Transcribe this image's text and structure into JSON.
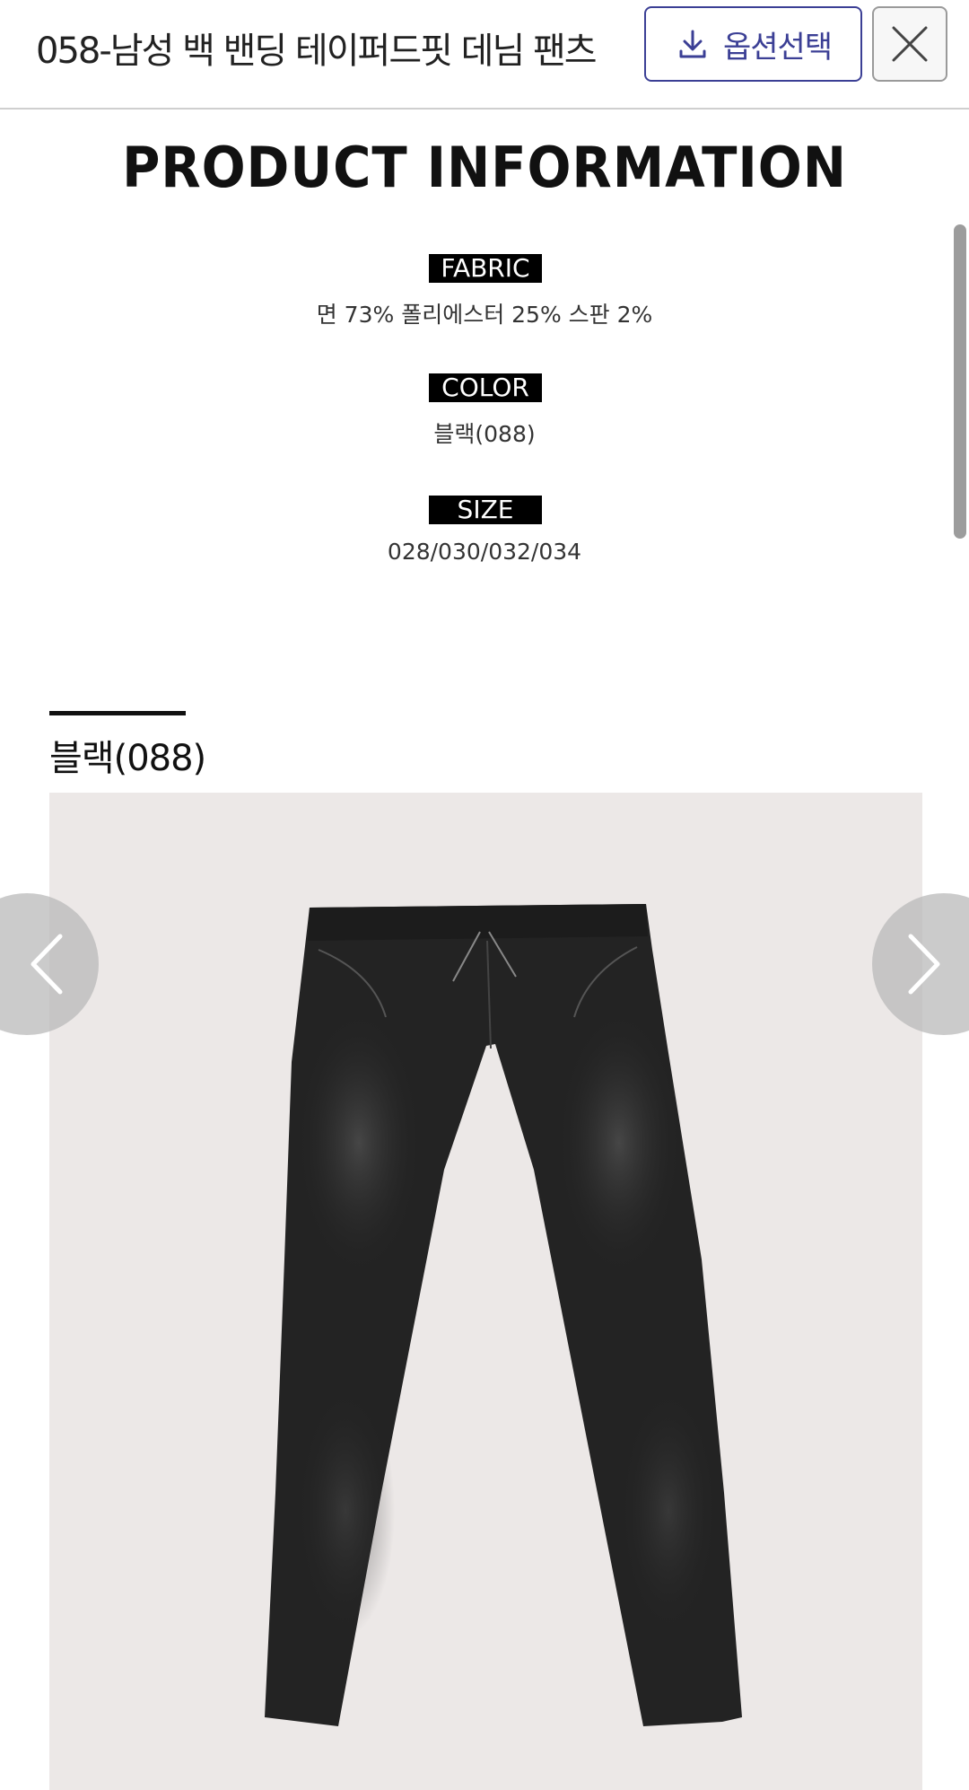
{
  "header": {
    "title": "058-남성 백 밴딩 테이퍼드핏 데님 팬츠",
    "option_button_label": "옵션선택",
    "option_icon": "download-icon",
    "close_icon": "close-icon"
  },
  "product_info": {
    "title": "PRODUCT INFORMATION",
    "fabric_label": "FABRIC",
    "fabric_value": "면 73% 폴리에스터 25% 스판 2%",
    "color_label": "COLOR",
    "color_value": "블랙(088)",
    "size_label": "SIZE",
    "size_value": "028/030/032/034"
  },
  "color_section": {
    "label": "블랙(088)"
  },
  "gallery": {
    "prev_icon": "chevron-left-icon",
    "next_icon": "chevron-right-icon",
    "image": "black-denim-pants-photo"
  },
  "colors": {
    "accent": "#3b3f95",
    "photo_bg": "#ece8e7",
    "denim": "#232323"
  }
}
